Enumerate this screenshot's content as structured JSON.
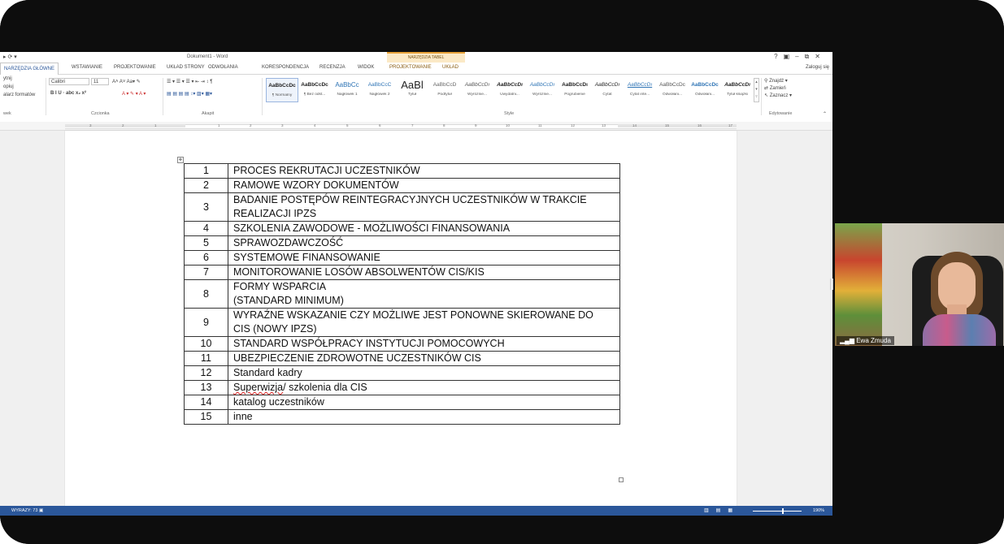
{
  "app": {
    "doc_title": "Dokument1 - Word",
    "context_tools": "NARZĘDZIA TABEL",
    "sign_in": "Zaloguj się"
  },
  "tabs": [
    {
      "label": "NARZĘDZIA GŁÓWNE",
      "active": true
    },
    {
      "label": "WSTAWIANIE"
    },
    {
      "label": "PROJEKTOWANIE"
    },
    {
      "label": "UKŁAD STRONY"
    },
    {
      "label": "ODWOŁANIA"
    },
    {
      "label": "KORESPONDENCJA"
    },
    {
      "label": "RECENZJA"
    },
    {
      "label": "WIDOK"
    },
    {
      "label": "PROJEKTOWANIE",
      "context": true
    },
    {
      "label": "UKŁAD",
      "context": true
    }
  ],
  "ribbon": {
    "clipboard_items": [
      "ytnij",
      "opiuj",
      "alarz formatów"
    ],
    "clipboard_group": "wek",
    "font_name": "Calibri",
    "font_size": "11",
    "font_group": "Czcionka",
    "paragraph_group": "Akapit",
    "styles_group": "Style",
    "editing_group": "Edytowanie",
    "edit_items": [
      "Znajdź",
      "Zamień",
      "Zaznacz"
    ],
    "styles": [
      {
        "preview": "AaBbCcDc",
        "name": "¶ Normalny",
        "selected": true
      },
      {
        "preview": "AaBbCcDc",
        "name": "¶ Bez odst..."
      },
      {
        "preview": "AaBbCc",
        "name": "Nagłówek 1"
      },
      {
        "preview": "AaBbCcC",
        "name": "Nagłówek 2"
      },
      {
        "preview": "AaBl",
        "name": "Tytuł"
      },
      {
        "preview": "AaBbCcD",
        "name": "Podtytuł"
      },
      {
        "preview": "AaBbCcDı",
        "name": "Wyróżnie..."
      },
      {
        "preview": "AaBbCcDı",
        "name": "Uwydatni..."
      },
      {
        "preview": "AaBbCcDı",
        "name": "Wyróżnie..."
      },
      {
        "preview": "AaBbCcDı",
        "name": "Pogrubienie"
      },
      {
        "preview": "AaBbCcDı",
        "name": "Cytat"
      },
      {
        "preview": "AaBbCcDı",
        "name": "Cytat inte..."
      },
      {
        "preview": "AaBbCcDc",
        "name": "Odwołani..."
      },
      {
        "preview": "AaBbCcDc",
        "name": "Odwołani..."
      },
      {
        "preview": "AaBbCcDı",
        "name": "Tytuł książki"
      }
    ]
  },
  "ruler_ticks": [
    "3",
    "2",
    "1",
    "1",
    "2",
    "3",
    "4",
    "5",
    "6",
    "7",
    "8",
    "9",
    "10",
    "11",
    "12",
    "13",
    "14",
    "15",
    "16",
    "17"
  ],
  "table_rows": [
    {
      "num": "1",
      "text": "PROCES REKRUTACJI UCZESTNIKÓW"
    },
    {
      "num": "2",
      "text": "RAMOWE WZORY DOKUMENTÓW"
    },
    {
      "num": "3",
      "text": "BADANIE POSTĘPÓW REINTEGRACYJNYCH UCZESTNIKÓW W TRAKCIE",
      "text2": "REALIZACJI IPZS"
    },
    {
      "num": "4",
      "text": "SZKOLENIA ZAWODOWE - MOŻLIWOŚCI FINANSOWANIA"
    },
    {
      "num": "5",
      "text": "SPRAWOZDAWCZOŚĆ"
    },
    {
      "num": "6",
      "text": "SYSTEMOWE FINANSOWANIE"
    },
    {
      "num": "7",
      "text": "MONITOROWANIE LOSÓW ABSOLWENTÓW CIS/KIS"
    },
    {
      "num": "8",
      "text": "FORMY WSPARCIA",
      "text2": "(STANDARD MINIMUM)"
    },
    {
      "num": "9",
      "text": "WYRAŹNE WSKAZANIE CZY MOŻLIWE JEST PONOWNE SKIEROWANE DO",
      "text2": "CIS (NOWY IPZS)"
    },
    {
      "num": "10",
      "text": "STANDARD WSPÓŁPRACY INSTYTUCJI POMOCOWYCH"
    },
    {
      "num": "11",
      "text": "UBEZPIECZENIE ZDROWOTNE UCZESTNIKÓW CIS"
    },
    {
      "num": "12",
      "text": "Standard kadry"
    },
    {
      "num": "13",
      "text_spell": "Superwizja",
      "text": "/ szkolenia dla CIS"
    },
    {
      "num": "14",
      "text": "katalog uczestników"
    },
    {
      "num": "15",
      "text": "inne"
    }
  ],
  "status": {
    "word_count": "WYRAZY: 73",
    "zoom": "190%"
  },
  "video": {
    "participant_name": "Ewa Zmuda",
    "signal_icon": "signal-bars-icon"
  }
}
